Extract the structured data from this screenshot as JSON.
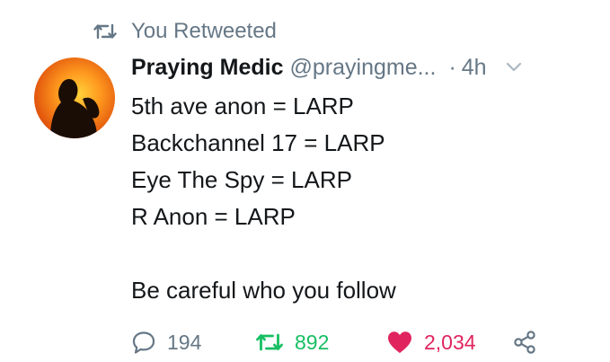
{
  "retweet_context": {
    "label": "You Retweeted",
    "icon": "retweet-icon"
  },
  "author": {
    "display_name": "Praying Medic",
    "handle": "@prayingme...",
    "separator": "·",
    "time": "4h",
    "avatar": "silhouette-sunset-avatar"
  },
  "tweet": {
    "lines": [
      "5th ave anon = LARP",
      "Backchannel 17 = LARP",
      "Eye The Spy = LARP",
      "R Anon = LARP",
      "",
      "Be careful who you follow"
    ]
  },
  "actions": {
    "reply_count": "194",
    "retweet_count": "892",
    "like_count": "2,034"
  },
  "colors": {
    "muted": "#657786",
    "retweet_green": "#17bf63",
    "like_red": "#e0245e",
    "text": "#14171a"
  }
}
